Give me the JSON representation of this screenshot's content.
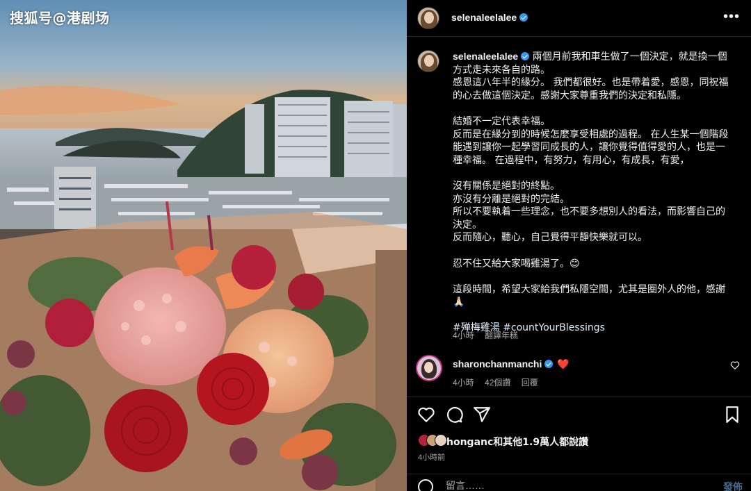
{
  "watermark": "搜狐号@港剧场",
  "post": {
    "username": "selenaleelalee",
    "more_icon": "more-horizontal-icon",
    "caption": {
      "username": "selenaleelalee",
      "lines": [
        "兩個月前我和車生做了一個決定，就是換一個方式走未來各自的路。",
        "感恩這八年半的緣分。 我們都很好。也是帶着愛，感恩，同祝福的心去做這個決定。感謝大家尊重我們的決定和私隱。",
        "",
        "結婚不一定代表幸福。",
        "反而是在緣分到的時候怎麼享受相處的過程。 在人生某一個階段能遇到讓你一起學習同成長的人，讓你覺得值得愛的人，也是一種幸福。 在過程中，有努力，有用心，有成長，有愛，",
        "",
        "沒有關係是絕對的終點。",
        "亦沒有分離是絕對的完結。",
        "所以不要執着一些理念，也不要多想別人的看法，而影響自己的決定。",
        "反而隨心，聽心，自己覺得平靜快樂就可以。",
        "",
        "忍不住又給大家喝雞湯了。😊",
        "",
        "這段時間，希望大家給我們私隱空間，尤其是圈外人的他，感謝🙏🏻",
        ""
      ],
      "hashtags": [
        "#殚梅雞湯",
        "#countYourBlessings"
      ],
      "time": "4小時",
      "translate": "翻譯年糕"
    },
    "comment": {
      "username": "sharonchanmanchi",
      "text": "❤️",
      "time": "4小時",
      "likes": "42個讚",
      "reply": "回覆"
    },
    "likes_summary": "hongan c和其他1.9萬人都說讚",
    "likes_user": "honganc",
    "likes_rest": "和其他1.9萬人都說讚",
    "post_time": "4小時前",
    "add_comment": {
      "placeholder": "留言……",
      "post_label": "發佈"
    }
  },
  "colors": {
    "background": "#000000",
    "verified": "#3897f0",
    "heart": "#ed4956",
    "muted": "#a8a8a8",
    "hashtag": "#e0f1ff"
  }
}
